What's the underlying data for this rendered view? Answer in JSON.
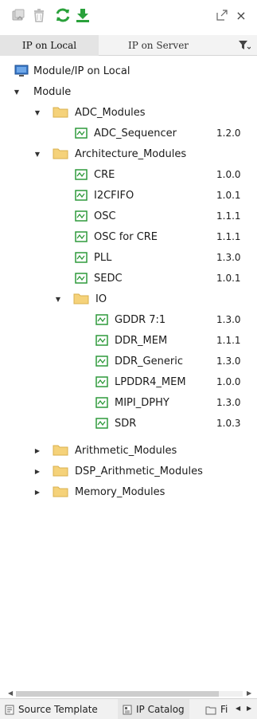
{
  "toolbar": {
    "icons": [
      "import-icon",
      "delete-icon",
      "refresh-icon",
      "download-icon",
      "maximize-icon",
      "close-icon"
    ],
    "close_glyph": "×"
  },
  "tabs": [
    {
      "label": "IP on Local",
      "active": true
    },
    {
      "label": "IP on Server",
      "active": false
    }
  ],
  "tree": {
    "root": "Module/IP on Local",
    "module": "Module",
    "adc": {
      "label": "ADC_Modules",
      "items": [
        {
          "label": "ADC_Sequencer",
          "version": "1.2.0"
        }
      ]
    },
    "arch": {
      "label": "Architecture_Modules",
      "items": [
        {
          "label": "CRE",
          "version": "1.0.0"
        },
        {
          "label": "I2CFIFO",
          "version": "1.0.1"
        },
        {
          "label": "OSC",
          "version": "1.1.1"
        },
        {
          "label": "OSC for CRE",
          "version": "1.1.1"
        },
        {
          "label": "PLL",
          "version": "1.3.0"
        },
        {
          "label": "SEDC",
          "version": "1.0.1"
        }
      ],
      "io": {
        "label": "IO",
        "items": [
          {
            "label": "GDDR 7:1",
            "version": "1.3.0"
          },
          {
            "label": "DDR_MEM",
            "version": "1.1.1"
          },
          {
            "label": "DDR_Generic",
            "version": "1.3.0"
          },
          {
            "label": "LPDDR4_MEM",
            "version": "1.0.0"
          },
          {
            "label": "MIPI_DPHY",
            "version": "1.3.0"
          },
          {
            "label": "SDR",
            "version": "1.0.3"
          }
        ]
      }
    },
    "collapsed": [
      "Arithmetic_Modules",
      "DSP_Arithmetic_Modules",
      "Memory_Modules"
    ]
  },
  "bottom_tabs": [
    {
      "label": "Source Template",
      "active": false
    },
    {
      "label": "IP Catalog",
      "active": true
    },
    {
      "label": "Fi",
      "active": false
    }
  ],
  "colors": {
    "folder": "#f5d27a",
    "ip_green": "#2f9a3c",
    "refresh_green": "#2aa13b"
  }
}
